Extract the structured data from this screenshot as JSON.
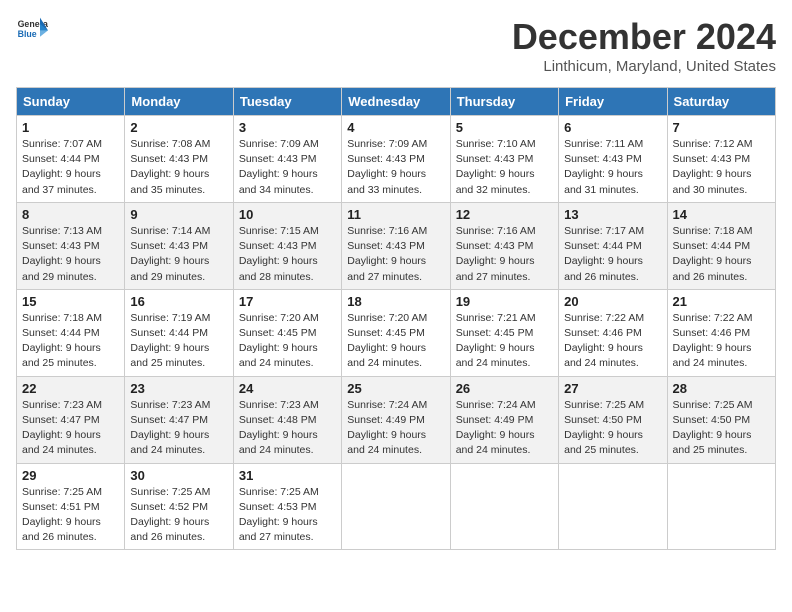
{
  "header": {
    "logo_general": "General",
    "logo_blue": "Blue",
    "title": "December 2024",
    "location": "Linthicum, Maryland, United States"
  },
  "weekdays": [
    "Sunday",
    "Monday",
    "Tuesday",
    "Wednesday",
    "Thursday",
    "Friday",
    "Saturday"
  ],
  "weeks": [
    [
      {
        "day": "1",
        "sunrise": "7:07 AM",
        "sunset": "4:44 PM",
        "daylight": "9 hours and 37 minutes."
      },
      {
        "day": "2",
        "sunrise": "7:08 AM",
        "sunset": "4:43 PM",
        "daylight": "9 hours and 35 minutes."
      },
      {
        "day": "3",
        "sunrise": "7:09 AM",
        "sunset": "4:43 PM",
        "daylight": "9 hours and 34 minutes."
      },
      {
        "day": "4",
        "sunrise": "7:09 AM",
        "sunset": "4:43 PM",
        "daylight": "9 hours and 33 minutes."
      },
      {
        "day": "5",
        "sunrise": "7:10 AM",
        "sunset": "4:43 PM",
        "daylight": "9 hours and 32 minutes."
      },
      {
        "day": "6",
        "sunrise": "7:11 AM",
        "sunset": "4:43 PM",
        "daylight": "9 hours and 31 minutes."
      },
      {
        "day": "7",
        "sunrise": "7:12 AM",
        "sunset": "4:43 PM",
        "daylight": "9 hours and 30 minutes."
      }
    ],
    [
      {
        "day": "8",
        "sunrise": "7:13 AM",
        "sunset": "4:43 PM",
        "daylight": "9 hours and 29 minutes."
      },
      {
        "day": "9",
        "sunrise": "7:14 AM",
        "sunset": "4:43 PM",
        "daylight": "9 hours and 29 minutes."
      },
      {
        "day": "10",
        "sunrise": "7:15 AM",
        "sunset": "4:43 PM",
        "daylight": "9 hours and 28 minutes."
      },
      {
        "day": "11",
        "sunrise": "7:16 AM",
        "sunset": "4:43 PM",
        "daylight": "9 hours and 27 minutes."
      },
      {
        "day": "12",
        "sunrise": "7:16 AM",
        "sunset": "4:43 PM",
        "daylight": "9 hours and 27 minutes."
      },
      {
        "day": "13",
        "sunrise": "7:17 AM",
        "sunset": "4:44 PM",
        "daylight": "9 hours and 26 minutes."
      },
      {
        "day": "14",
        "sunrise": "7:18 AM",
        "sunset": "4:44 PM",
        "daylight": "9 hours and 26 minutes."
      }
    ],
    [
      {
        "day": "15",
        "sunrise": "7:18 AM",
        "sunset": "4:44 PM",
        "daylight": "9 hours and 25 minutes."
      },
      {
        "day": "16",
        "sunrise": "7:19 AM",
        "sunset": "4:44 PM",
        "daylight": "9 hours and 25 minutes."
      },
      {
        "day": "17",
        "sunrise": "7:20 AM",
        "sunset": "4:45 PM",
        "daylight": "9 hours and 24 minutes."
      },
      {
        "day": "18",
        "sunrise": "7:20 AM",
        "sunset": "4:45 PM",
        "daylight": "9 hours and 24 minutes."
      },
      {
        "day": "19",
        "sunrise": "7:21 AM",
        "sunset": "4:45 PM",
        "daylight": "9 hours and 24 minutes."
      },
      {
        "day": "20",
        "sunrise": "7:22 AM",
        "sunset": "4:46 PM",
        "daylight": "9 hours and 24 minutes."
      },
      {
        "day": "21",
        "sunrise": "7:22 AM",
        "sunset": "4:46 PM",
        "daylight": "9 hours and 24 minutes."
      }
    ],
    [
      {
        "day": "22",
        "sunrise": "7:23 AM",
        "sunset": "4:47 PM",
        "daylight": "9 hours and 24 minutes."
      },
      {
        "day": "23",
        "sunrise": "7:23 AM",
        "sunset": "4:47 PM",
        "daylight": "9 hours and 24 minutes."
      },
      {
        "day": "24",
        "sunrise": "7:23 AM",
        "sunset": "4:48 PM",
        "daylight": "9 hours and 24 minutes."
      },
      {
        "day": "25",
        "sunrise": "7:24 AM",
        "sunset": "4:49 PM",
        "daylight": "9 hours and 24 minutes."
      },
      {
        "day": "26",
        "sunrise": "7:24 AM",
        "sunset": "4:49 PM",
        "daylight": "9 hours and 24 minutes."
      },
      {
        "day": "27",
        "sunrise": "7:25 AM",
        "sunset": "4:50 PM",
        "daylight": "9 hours and 25 minutes."
      },
      {
        "day": "28",
        "sunrise": "7:25 AM",
        "sunset": "4:50 PM",
        "daylight": "9 hours and 25 minutes."
      }
    ],
    [
      {
        "day": "29",
        "sunrise": "7:25 AM",
        "sunset": "4:51 PM",
        "daylight": "9 hours and 26 minutes."
      },
      {
        "day": "30",
        "sunrise": "7:25 AM",
        "sunset": "4:52 PM",
        "daylight": "9 hours and 26 minutes."
      },
      {
        "day": "31",
        "sunrise": "7:25 AM",
        "sunset": "4:53 PM",
        "daylight": "9 hours and 27 minutes."
      },
      null,
      null,
      null,
      null
    ]
  ]
}
